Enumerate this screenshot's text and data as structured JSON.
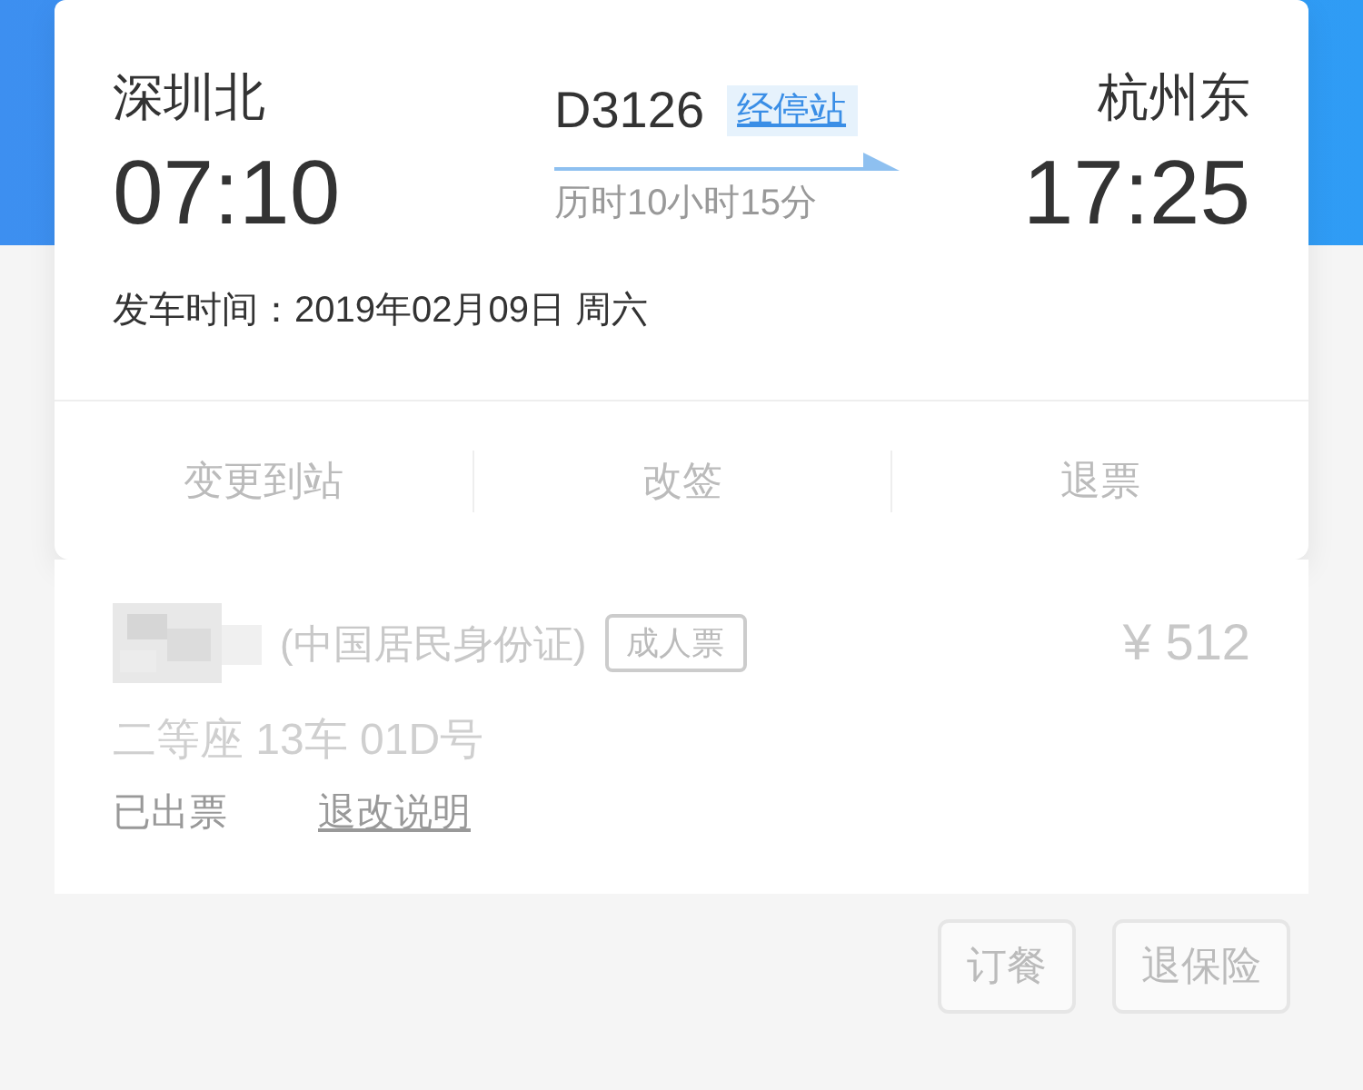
{
  "trip": {
    "from_station": "深圳北",
    "depart_time": "07:10",
    "train_no": "D3126",
    "stops_link": "经停站",
    "duration": "历时10小时15分",
    "to_station": "杭州东",
    "arrive_time": "17:25",
    "date_label": "发车时间：",
    "date": "2019年02月09日 周六"
  },
  "actions": [
    {
      "label": "变更到站"
    },
    {
      "label": "改签"
    },
    {
      "label": "退票"
    }
  ],
  "passenger": {
    "id_type": "(中国居民身份证)",
    "ticket_type": "成人票",
    "price": "¥ 512",
    "seat": "二等座 13车 01D号",
    "status": "已出票",
    "rules_link": "退改说明"
  },
  "buttons": [
    {
      "label": "订餐"
    },
    {
      "label": "退保险"
    }
  ]
}
